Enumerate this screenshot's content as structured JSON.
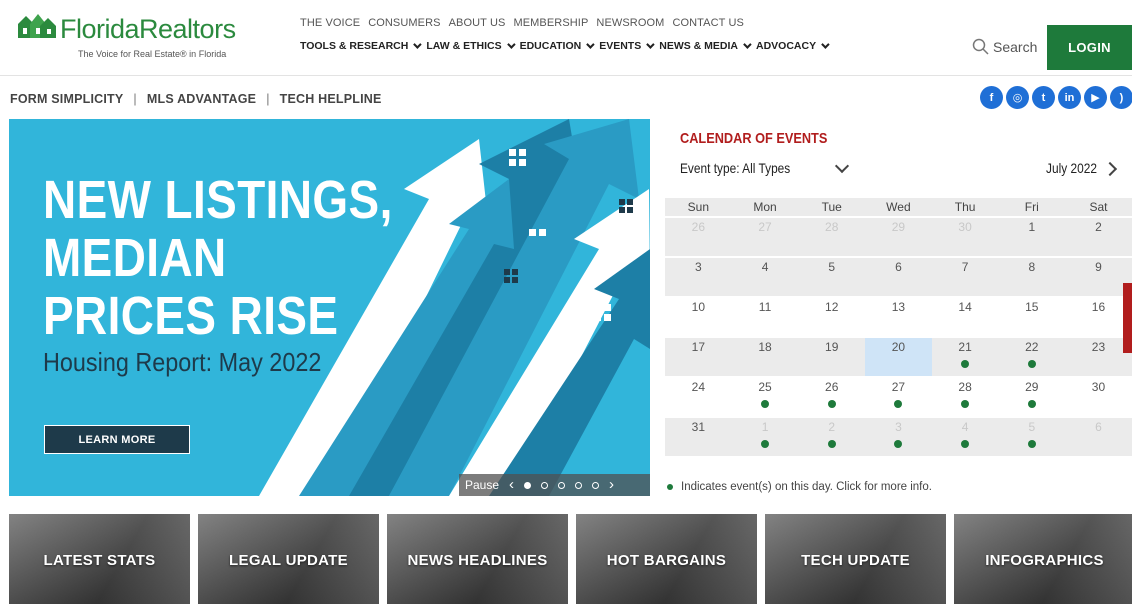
{
  "header": {
    "logo_name": "FloridaRealtors",
    "logo_tagline": "The Voice for Real Estate® in Florida",
    "top_links": [
      "THE VOICE",
      "CONSUMERS",
      "ABOUT US",
      "MEMBERSHIP",
      "NEWSROOM",
      "CONTACT US"
    ],
    "main_nav": [
      "TOOLS & RESEARCH",
      "LAW & ETHICS",
      "EDUCATION",
      "EVENTS",
      "NEWS & MEDIA",
      "ADVOCACY"
    ],
    "search_label": "Search",
    "login_label": "LOGIN"
  },
  "quick_links": [
    "FORM SIMPLICITY",
    "MLS ADVANTAGE",
    "TECH HELPLINE"
  ],
  "quick_separator": "|",
  "social_icons": [
    {
      "name": "facebook-icon",
      "glyph": "f"
    },
    {
      "name": "instagram-icon",
      "glyph": "◎"
    },
    {
      "name": "twitter-icon",
      "glyph": "t"
    },
    {
      "name": "linkedin-icon",
      "glyph": "in"
    },
    {
      "name": "youtube-icon",
      "glyph": "▶"
    },
    {
      "name": "rss-icon",
      "glyph": ")"
    }
  ],
  "hero": {
    "title_lines": [
      "NEW LISTINGS,",
      "MEDIAN",
      "PRICES RISE"
    ],
    "subtitle": "Housing Report: May 2022",
    "cta": "LEARN MORE",
    "pause_label": "Pause",
    "slide_count": 5,
    "active_slide": 1
  },
  "calendar": {
    "title": "CALENDAR OF EVENTS",
    "event_type": "Event type:  All Types",
    "month": "July 2022",
    "weekdays": [
      "Sun",
      "Mon",
      "Tue",
      "Wed",
      "Thu",
      "Fri",
      "Sat"
    ],
    "weeks": [
      [
        {
          "d": "26",
          "m": 1
        },
        {
          "d": "27",
          "m": 1
        },
        {
          "d": "28",
          "m": 1
        },
        {
          "d": "29",
          "m": 1
        },
        {
          "d": "30",
          "m": 1
        },
        {
          "d": "1"
        },
        {
          "d": "2"
        }
      ],
      [
        {
          "d": "3"
        },
        {
          "d": "4"
        },
        {
          "d": "5"
        },
        {
          "d": "6"
        },
        {
          "d": "7"
        },
        {
          "d": "8"
        },
        {
          "d": "9"
        }
      ],
      [
        {
          "d": "10"
        },
        {
          "d": "11"
        },
        {
          "d": "12"
        },
        {
          "d": "13"
        },
        {
          "d": "14"
        },
        {
          "d": "15"
        },
        {
          "d": "16"
        }
      ],
      [
        {
          "d": "17"
        },
        {
          "d": "18"
        },
        {
          "d": "19"
        },
        {
          "d": "20",
          "t": 1
        },
        {
          "d": "21",
          "e": 1
        },
        {
          "d": "22",
          "e": 1
        },
        {
          "d": "23"
        }
      ],
      [
        {
          "d": "24"
        },
        {
          "d": "25",
          "e": 1
        },
        {
          "d": "26",
          "e": 1
        },
        {
          "d": "27",
          "e": 1
        },
        {
          "d": "28",
          "e": 1
        },
        {
          "d": "29",
          "e": 1
        },
        {
          "d": "30"
        }
      ],
      [
        {
          "d": "31"
        },
        {
          "d": "1",
          "m": 1,
          "e": 1
        },
        {
          "d": "2",
          "m": 1,
          "e": 1
        },
        {
          "d": "3",
          "m": 1,
          "e": 1
        },
        {
          "d": "4",
          "m": 1,
          "e": 1
        },
        {
          "d": "5",
          "m": 1,
          "e": 1
        },
        {
          "d": "6",
          "m": 1
        }
      ]
    ],
    "legend": "Indicates event(s) on this day. Click for more info.",
    "event_color": "#1e7a3b"
  },
  "tiles": [
    "LATEST STATS",
    "LEGAL UPDATE",
    "NEWS HEADLINES",
    "HOT BARGAINS",
    "TECH UPDATE",
    "INFOGRAPHICS"
  ],
  "colors": {
    "brand_green": "#1e7a3b",
    "hero_blue": "#31b5da",
    "calendar_red": "#b11d1d",
    "social_blue": "#1f6fd6"
  }
}
